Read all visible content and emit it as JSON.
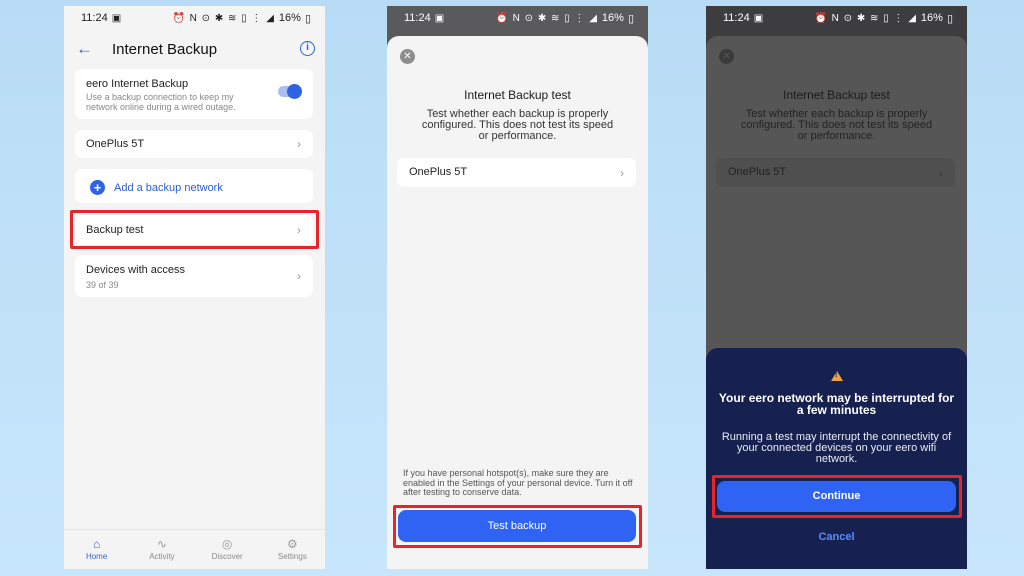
{
  "status": {
    "time": "11:24",
    "battery": "16%"
  },
  "screen1": {
    "title": "Internet Backup",
    "backup_card": {
      "title": "eero Internet Backup",
      "description": "Use a backup connection to keep my network online during a wired outage.",
      "toggle_on": true
    },
    "network": "OnePlus 5T",
    "add_network": "Add a backup network",
    "backup_test": "Backup test",
    "devices": {
      "title": "Devices with access",
      "count": "39 of 39"
    },
    "nav": [
      {
        "label": "Home",
        "icon": "home-icon"
      },
      {
        "label": "Activity",
        "icon": "activity-icon"
      },
      {
        "label": "Discover",
        "icon": "discover-icon"
      },
      {
        "label": "Settings",
        "icon": "settings-icon"
      }
    ]
  },
  "screen2": {
    "title": "Internet Backup test",
    "description": "Test whether each backup is properly configured. This does not test its speed or performance.",
    "network": "OnePlus 5T",
    "note": "If you have personal hotspot(s), make sure they are enabled in the Settings of your personal device. Turn it off after testing to conserve data.",
    "button": "Test backup"
  },
  "screen3": {
    "title": "Internet Backup test",
    "description": "Test whether each backup is properly configured. This does not test its speed or performance.",
    "network": "OnePlus 5T",
    "modal": {
      "title": "Your eero network may be interrupted for a few minutes",
      "body": "Running a test may interrupt the connectivity of your connected devices on your eero wifi network.",
      "continue": "Continue",
      "cancel": "Cancel"
    }
  },
  "colors": {
    "accent": "#2f63f3",
    "highlight": "#e4262b",
    "modal_bg": "#162150",
    "warning": "#f0a33a"
  }
}
